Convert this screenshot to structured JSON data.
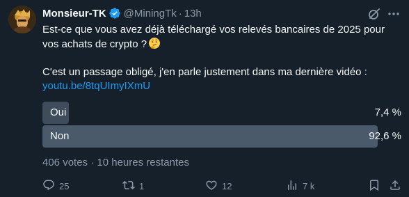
{
  "tweet": {
    "author": {
      "display_name": "Monsieur-TK",
      "handle": "@MiningTk",
      "separator": "·",
      "time": "13h",
      "verified": true
    },
    "text": {
      "line1": "Est-ce que vous avez déjà téléchargé vos relevés bancaires de 2025 pour vos achats de crypto ?",
      "line1_emoji": "thinking-face",
      "line2": "C'est un passage obligé, j'en parle justement dans ma dernière vidéo :",
      "link": "youtu.be/8tqUImyIXmU"
    },
    "poll": {
      "options": [
        {
          "label": "Oui",
          "percent_text": "7,4 %",
          "percent": 7.4,
          "leading": false
        },
        {
          "label": "Non",
          "percent_text": "92,6 %",
          "percent": 92.6,
          "leading": true
        }
      ],
      "votes": "406 votes",
      "separator": "·",
      "remaining": "10 heures restantes"
    },
    "actions": {
      "replies": "25",
      "reposts": "1",
      "likes": "12",
      "views": "7 k"
    },
    "colors": {
      "background": "#15202b",
      "text": "#f7f9f9",
      "muted": "#8b98a5",
      "link": "#1d9bf0",
      "verified": "#1d9bf0",
      "poll_fill": "#3f4c5b"
    }
  }
}
